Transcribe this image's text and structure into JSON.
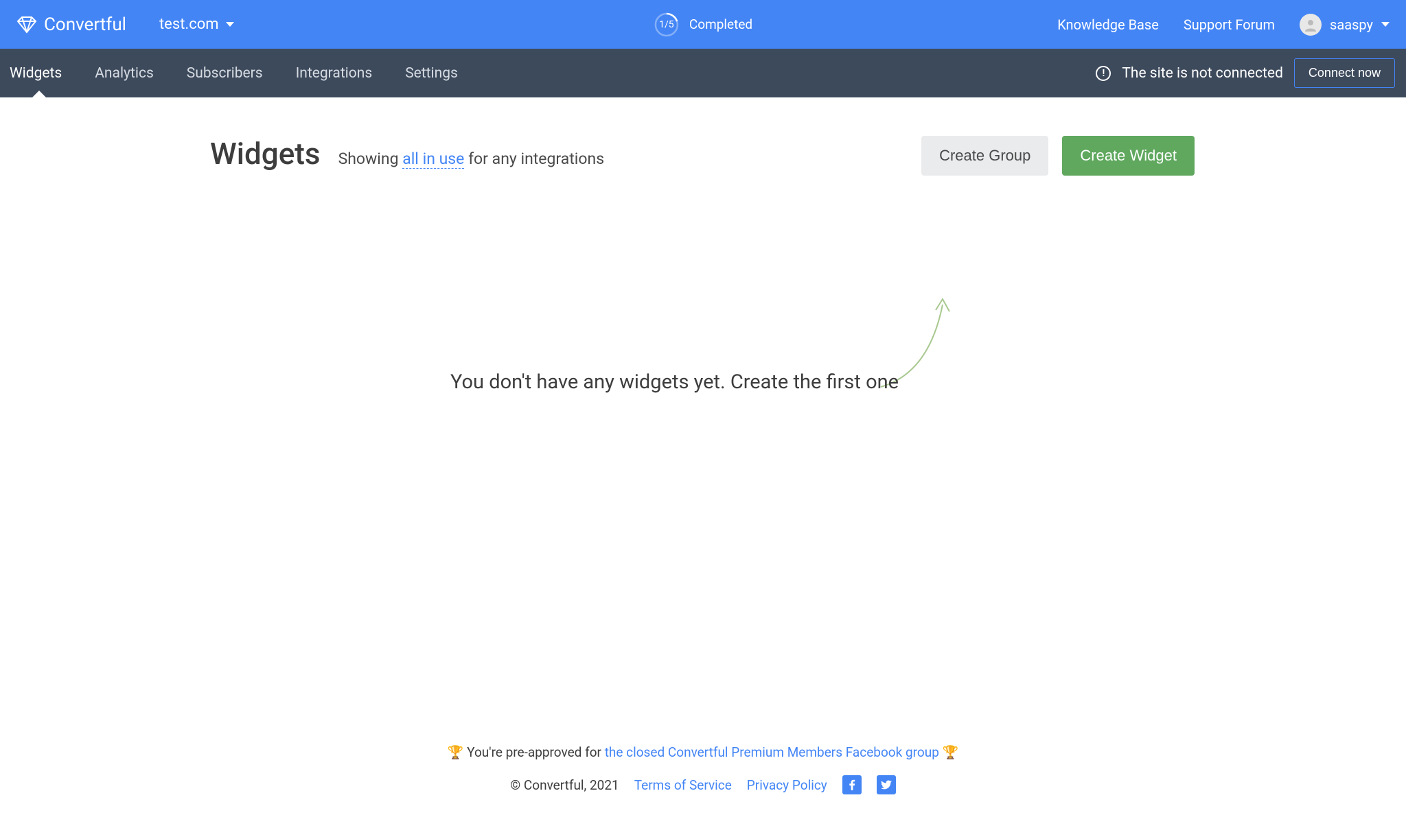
{
  "header": {
    "brand": "Convertful",
    "site": "test.com",
    "progress_fraction": "1/5",
    "progress_label": "Completed",
    "links": {
      "knowledge_base": "Knowledge Base",
      "support_forum": "Support Forum"
    },
    "user": "saaspy"
  },
  "nav": {
    "items": [
      "Widgets",
      "Analytics",
      "Subscribers",
      "Integrations",
      "Settings"
    ],
    "warning": "The site is not connected",
    "connect_btn": "Connect now"
  },
  "main": {
    "title": "Widgets",
    "filter_prefix": "Showing ",
    "filter_link": "all in use",
    "filter_suffix": " for any integrations",
    "create_group_btn": "Create Group",
    "create_widget_btn": "Create Widget",
    "empty_message": "You don't have any widgets yet. Create the first one"
  },
  "footer": {
    "trophy": "🏆",
    "preapproved_prefix": " You're pre-approved for ",
    "preapproved_link": "the closed Convertful Premium Members Facebook group",
    "copyright": "© Convertful, 2021",
    "terms": "Terms of Service",
    "privacy": "Privacy Policy"
  }
}
